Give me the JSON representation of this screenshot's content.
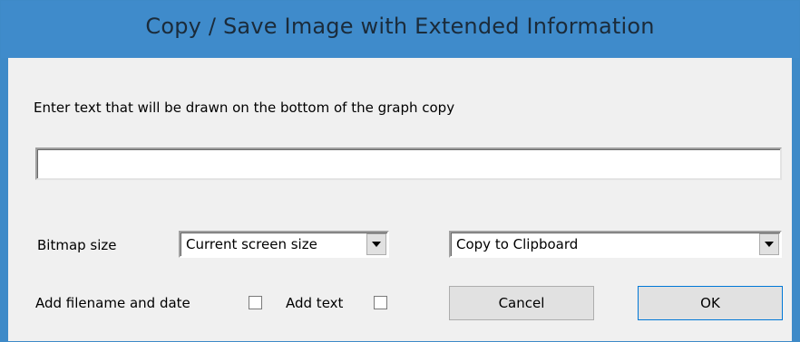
{
  "dialog": {
    "title": "Copy / Save Image with Extended Information",
    "instruction_label": "Enter text that will be drawn on the bottom of the graph copy",
    "text_input_value": "",
    "bitmap_size_label": "Bitmap size",
    "bitmap_size_value": "Current screen size",
    "destination_value": "Copy to Clipboard",
    "add_filename_date_label": "Add filename and date",
    "add_filename_date_checked": false,
    "add_text_label": "Add text",
    "add_text_checked": false,
    "cancel_label": "Cancel",
    "ok_label": "OK"
  },
  "icons": {
    "dropdown": "chevron-down-icon",
    "checkbox": "checkbox-unchecked"
  },
  "colors": {
    "titlebar": "#3f8bcb",
    "client_bg": "#f0f0f0",
    "button_bg": "#e1e1e1",
    "default_button_border": "#0078d7"
  }
}
